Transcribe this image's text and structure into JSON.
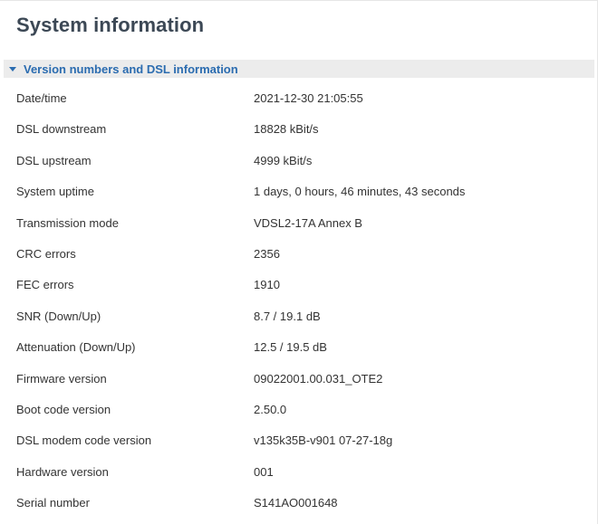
{
  "page": {
    "title": "System information"
  },
  "section": {
    "title": "Version numbers and DSL information"
  },
  "rows": [
    {
      "label": "Date/time",
      "value": "2021-12-30 21:05:55"
    },
    {
      "label": "DSL downstream",
      "value": "18828 kBit/s"
    },
    {
      "label": "DSL upstream",
      "value": "4999 kBit/s"
    },
    {
      "label": "System uptime",
      "value": "1 days, 0 hours, 46 minutes, 43 seconds"
    },
    {
      "label": "Transmission mode",
      "value": "VDSL2-17A Annex B"
    },
    {
      "label": "CRC errors",
      "value": "2356"
    },
    {
      "label": "FEC errors",
      "value": "1910"
    },
    {
      "label": "SNR (Down/Up)",
      "value": "8.7 / 19.1 dB"
    },
    {
      "label": "Attenuation (Down/Up)",
      "value": "12.5 / 19.5 dB"
    },
    {
      "label": "Firmware version",
      "value": "09022001.00.031_OTE2"
    },
    {
      "label": "Boot code version",
      "value": "2.50.0"
    },
    {
      "label": "DSL modem code version",
      "value": "v135k35B-v901 07-27-18g"
    },
    {
      "label": "Hardware version",
      "value": "001"
    },
    {
      "label": "Serial number",
      "value": "S141AO001648"
    }
  ],
  "colors": {
    "title": "#3c4855",
    "accent": "#2b6cb0",
    "section_bg": "#ececec",
    "text": "#333333"
  },
  "icons": {
    "section_toggle": "caret-down-icon"
  }
}
